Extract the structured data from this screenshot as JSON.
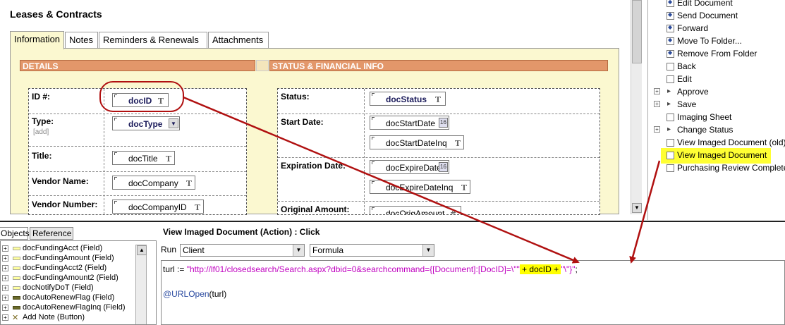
{
  "form": {
    "title": "Leases & Contracts",
    "tabs": [
      "Information",
      "Notes",
      "Reminders & Renewals",
      "Attachments"
    ],
    "details": {
      "header": "DETAILS",
      "rows": [
        {
          "label": "ID #:",
          "field": "docID",
          "sub": ""
        },
        {
          "label": "Type:",
          "field": "docType",
          "sub": "[add]"
        },
        {
          "label": "Title:",
          "field": "docTitle",
          "sub": ""
        },
        {
          "label": "Vendor Name:",
          "field": "docCompany",
          "sub": ""
        },
        {
          "label": "Vendor Number:",
          "field": "docCompanyID",
          "sub": ""
        }
      ]
    },
    "status": {
      "header": "STATUS & FINANCIAL INFO",
      "rows": [
        {
          "label": "Status:",
          "fields": [
            "docStatus"
          ]
        },
        {
          "label": "Start Date:",
          "fields": [
            "docStartDate",
            "docStartDateInq"
          ]
        },
        {
          "label": "Expiration Date:",
          "fields": [
            "docExpireDate",
            "docExpireDateInq"
          ]
        },
        {
          "label": "Original Amount:",
          "fields": [
            "docOrigAmount"
          ]
        }
      ]
    },
    "icons": {
      "text": "T",
      "calendar": "16",
      "number": "#"
    }
  },
  "actions": [
    {
      "label": "Edit Document",
      "kind": "action"
    },
    {
      "label": "Send Document",
      "kind": "action"
    },
    {
      "label": "Forward",
      "kind": "action"
    },
    {
      "label": "Move To Folder...",
      "kind": "action"
    },
    {
      "label": "Remove From Folder",
      "kind": "action"
    },
    {
      "label": "Back",
      "kind": "simple"
    },
    {
      "label": "Edit",
      "kind": "simple"
    },
    {
      "label": "Approve",
      "kind": "group"
    },
    {
      "label": "Save",
      "kind": "group"
    },
    {
      "label": "Imaging Sheet",
      "kind": "simple"
    },
    {
      "label": "Change Status",
      "kind": "group"
    },
    {
      "label": "View Imaged Document (old)",
      "kind": "simple"
    },
    {
      "label": "View Imaged Document",
      "kind": "simple",
      "highlighted": true
    },
    {
      "label": "Purchasing Review Completed",
      "kind": "simple"
    }
  ],
  "objects": {
    "tabs": [
      "Objects",
      "Reference"
    ],
    "items": [
      {
        "label": "docFundingAcct (Field)",
        "icon": "field"
      },
      {
        "label": "docFundingAmount (Field)",
        "icon": "field"
      },
      {
        "label": "docFundingAcct2 (Field)",
        "icon": "field"
      },
      {
        "label": "docFundingAmount2 (Field)",
        "icon": "field"
      },
      {
        "label": "docNotifyDoT (Field)",
        "icon": "field"
      },
      {
        "label": "docAutoRenewFlag (Field)",
        "icon": "field-dark"
      },
      {
        "label": "docAutoRenewFlagInq (Field)",
        "icon": "field-dark"
      },
      {
        "label": "Add Note (Button)",
        "icon": "button"
      }
    ]
  },
  "editor": {
    "header": "View Imaged Document (Action) : Click",
    "run_label": "Run",
    "run_value": "Client",
    "lang_value": "Formula",
    "code": {
      "p1": "turl := ",
      "p2": "\"http://lf01/closedsearch/Search.aspx?dbid=0&searchcommand={[Document]:[DocID]=\\\"\"",
      "p3": " + docID + ",
      "p4": "\"\\\"}\"",
      "p5": ";",
      "fn": "@URLOpen",
      "arg": "(turl)"
    }
  },
  "colors": {
    "section_header": "#e3976a",
    "highlight": "#ffff00",
    "annotation": "#b01010"
  }
}
